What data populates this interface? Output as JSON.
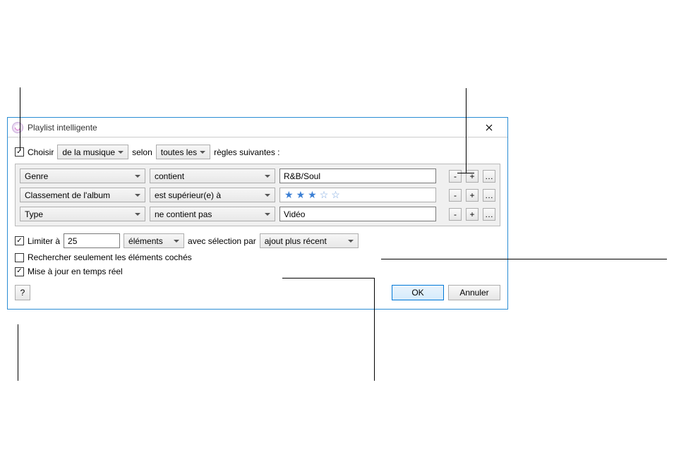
{
  "dialog": {
    "title": "Playlist intelligente",
    "close_icon": "close"
  },
  "match": {
    "checked": true,
    "choose_label": "Choisir",
    "source_select": "de la musique",
    "link_text": "selon",
    "quantifier_select": "toutes les",
    "suffix_text": "règles suivantes :"
  },
  "rules": [
    {
      "field": "Genre",
      "operator": "contient",
      "value": "R&B/Soul",
      "type": "text"
    },
    {
      "field": "Classement de l'album",
      "operator": "est supérieur(e) à",
      "rating": 3,
      "type": "rating"
    },
    {
      "field": "Type",
      "operator": "ne contient pas",
      "value": "Vidéo",
      "type": "text"
    }
  ],
  "rule_buttons": {
    "remove": "-",
    "add": "+",
    "more": "…"
  },
  "limit": {
    "checked": true,
    "label": "Limiter à",
    "value": "25",
    "unit": "éléments",
    "by_label": "avec sélection par",
    "selection": "ajout plus récent"
  },
  "checked_only": {
    "checked": false,
    "label": "Rechercher seulement les éléments cochés"
  },
  "live_update": {
    "checked": true,
    "label": "Mise à jour en temps réel"
  },
  "buttons": {
    "help": "?",
    "ok": "OK",
    "cancel": "Annuler"
  }
}
